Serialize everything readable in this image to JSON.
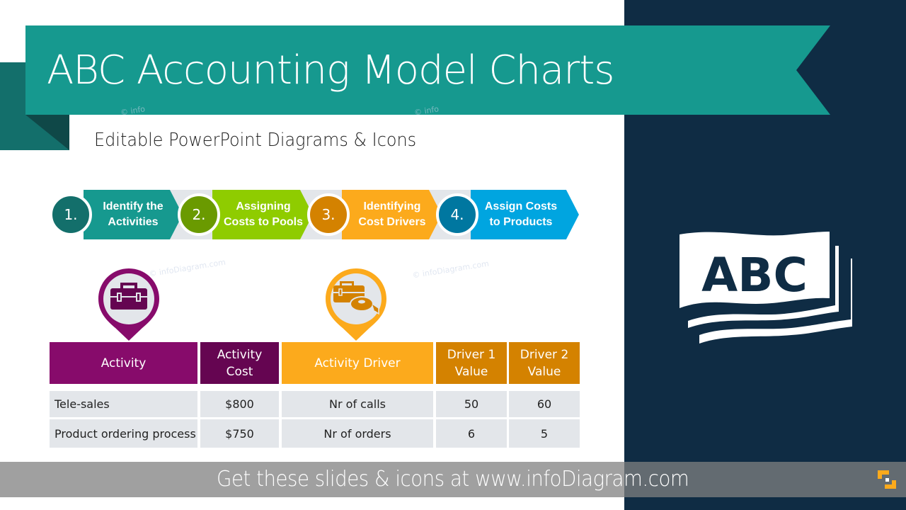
{
  "header": {
    "title": "ABC Accounting Model Charts",
    "subtitle": "Editable PowerPoint Diagrams & Icons"
  },
  "watermarks": [
    "© infoDiagram.com",
    "© infoDiagram.com",
    "© info",
    "© info"
  ],
  "process": {
    "steps": [
      {
        "number": "1.",
        "label_line1": "Identify the",
        "label_line2": "Activities",
        "color": "#16998f",
        "circle_color": "#136f6b"
      },
      {
        "number": "2.",
        "label_line1": "Assigning",
        "label_line2": "Costs to Pools",
        "color": "#8fcc00",
        "circle_color": "#6a9a00"
      },
      {
        "number": "3.",
        "label_line1": "Identifying",
        "label_line2": "Cost Drivers",
        "color": "#fcaa1c",
        "circle_color": "#d48200"
      },
      {
        "number": "4.",
        "label_line1": "Assign Costs",
        "label_line2": "to Products",
        "color": "#00a5e0",
        "circle_color": "#0077a0"
      }
    ]
  },
  "icons": {
    "activity_pin": {
      "icon": "toolbox-icon",
      "color": "#870b6b"
    },
    "driver_pin": {
      "icon": "toolbox-measuring-tape-icon",
      "color": "#fcaa1c"
    }
  },
  "table": {
    "headers": [
      {
        "line1": "Activity",
        "line2": "",
        "color": "#870b6b"
      },
      {
        "line1": "Activity",
        "line2": "Cost",
        "color": "#650551"
      },
      {
        "line1": "Activity Driver",
        "line2": "",
        "color": "#fcaa1c"
      },
      {
        "line1": "Driver 1",
        "line2": "Value",
        "color": "#d48200"
      },
      {
        "line1": "Driver 2",
        "line2": "Value",
        "color": "#d48200"
      }
    ],
    "rows": [
      [
        "Tele-sales",
        "$800",
        "Nr of calls",
        "50",
        "60"
      ],
      [
        "Product ordering process",
        "$750",
        "Nr of orders",
        "6",
        "5"
      ]
    ]
  },
  "side_icon": {
    "name": "abc-book-icon",
    "text": "ABC"
  },
  "footer": {
    "text": "Get these slides & icons at www.infoDiagram.com",
    "logo": "infodiagram-logo-icon"
  },
  "colors": {
    "teal": "#16998f",
    "dark_teal": "#136f6b",
    "navy": "#0f2c44",
    "purple": "#870b6b",
    "orange": "#fcaa1c"
  }
}
